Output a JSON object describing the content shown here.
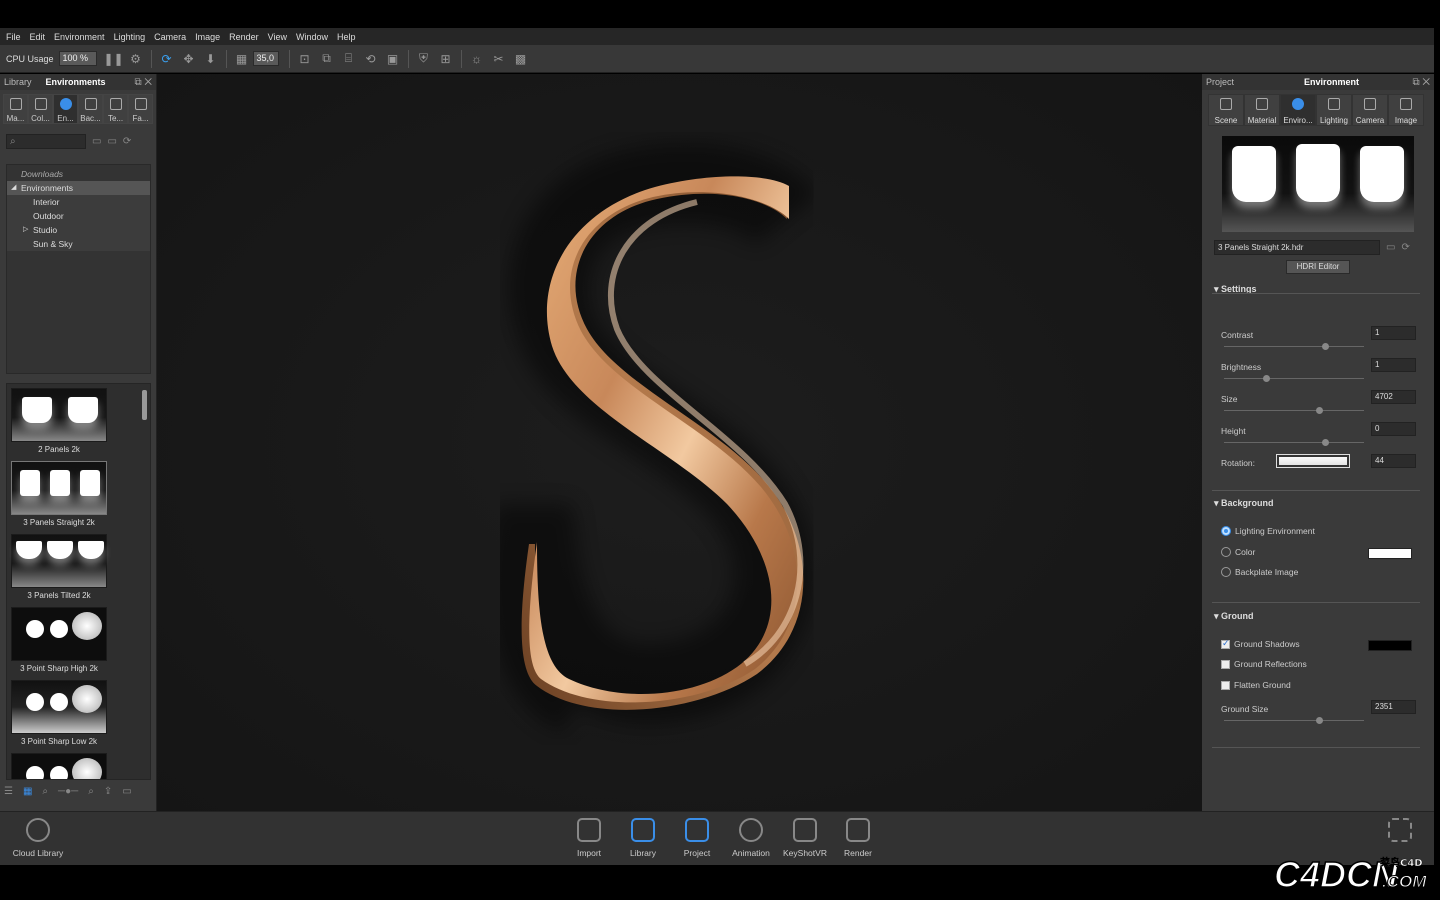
{
  "menu": [
    "File",
    "Edit",
    "Environment",
    "Lighting",
    "Camera",
    "Image",
    "Render",
    "View",
    "Window",
    "Help"
  ],
  "toolbar": {
    "cpu_label": "CPU Usage",
    "cpu_value": "100 %",
    "fov_value": "35,0"
  },
  "library": {
    "title_left": "Library",
    "title": "Environments",
    "tabs": [
      "Ma...",
      "Col...",
      "En...",
      "Bac...",
      "Te...",
      "Fa..."
    ],
    "search_icon": "⌕",
    "tree": [
      "Downloads",
      "Environments",
      "Interior",
      "Outdoor",
      "Studio",
      "Sun & Sky"
    ],
    "thumbnails": [
      "2 Panels 2k",
      "3 Panels Straight 2k",
      "3 Panels Tilted 2k",
      "3 Point Sharp High 2k",
      "3 Point Sharp Low 2k"
    ]
  },
  "project": {
    "title_left": "Project",
    "title": "Environment",
    "tabs": [
      "Scene",
      "Material",
      "Enviro...",
      "Lighting",
      "Camera",
      "Image"
    ],
    "hdr_file": "3 Panels Straight 2k.hdr",
    "hdri_button": "HDRI Editor",
    "settings_title": "Settings",
    "settings": [
      {
        "name": "Contrast",
        "value": "1",
        "knob": 0.72
      },
      {
        "name": "Brightness",
        "value": "1",
        "knob": 0.3
      },
      {
        "name": "Size",
        "value": "4702",
        "knob": 0.68
      },
      {
        "name": "Height",
        "value": "0",
        "knob": 0.72
      },
      {
        "name": "Rotation:",
        "value": "44"
      }
    ],
    "background_title": "Background",
    "background_options": [
      "Lighting Environment",
      "Color",
      "Backplate Image"
    ],
    "ground_title": "Ground",
    "ground_options": [
      "Ground Shadows",
      "Ground Reflections",
      "Flatten Ground"
    ],
    "ground_size_label": "Ground Size",
    "ground_size_value": "2351",
    "ground_size_knob": 0.68,
    "colors": {
      "background_swatch": "#ffffff",
      "shadow_swatch": "#000000",
      "accent": "#3a8ee8",
      "letter": "#c48a56"
    }
  },
  "bottom": {
    "cloud_library": "Cloud Library",
    "buttons": [
      "Import",
      "Library",
      "Project",
      "Animation",
      "KeyShotVR",
      "Render"
    ]
  },
  "watermark": {
    "main": "C4DCN",
    "small_top": "菜鸟C4D",
    "small_bottom": ".COM"
  }
}
